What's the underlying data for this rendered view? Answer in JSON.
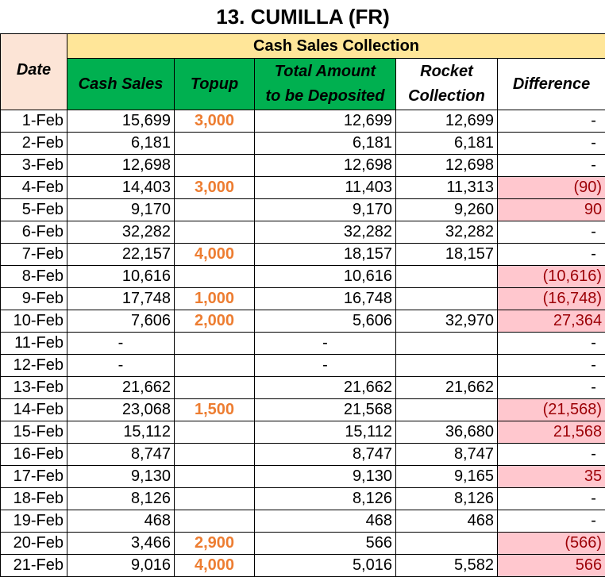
{
  "title": "13. CUMILLA (FR)",
  "header": {
    "date": "Date",
    "group": "Cash Sales Collection",
    "cash_sales": "Cash Sales",
    "topup": "Topup",
    "total_line1": "Total Amount",
    "total_line2": "to be Deposited",
    "rocket_line1": "Rocket",
    "rocket_line2": "Collection",
    "difference": "Difference"
  },
  "colors": {
    "date_header_bg": "#fce4d6",
    "group_header_bg": "#ffe699",
    "green_header_bg": "#00b050",
    "topup_text": "#ed7d31",
    "diff_highlight_bg": "#ffc7ce",
    "diff_highlight_text": "#9c0006"
  },
  "rows": [
    {
      "date": "1-Feb",
      "cash_sales": "15,699",
      "topup": "3,000",
      "total": "12,699",
      "rocket": "12,699",
      "difference": "-",
      "diff_flag": false
    },
    {
      "date": "2-Feb",
      "cash_sales": "6,181",
      "topup": "",
      "total": "6,181",
      "rocket": "6,181",
      "difference": "-",
      "diff_flag": false
    },
    {
      "date": "3-Feb",
      "cash_sales": "12,698",
      "topup": "",
      "total": "12,698",
      "rocket": "12,698",
      "difference": "-",
      "diff_flag": false
    },
    {
      "date": "4-Feb",
      "cash_sales": "14,403",
      "topup": "3,000",
      "total": "11,403",
      "rocket": "11,313",
      "difference": "(90)",
      "diff_flag": true
    },
    {
      "date": "5-Feb",
      "cash_sales": "9,170",
      "topup": "",
      "total": "9,170",
      "rocket": "9,260",
      "difference": "90",
      "diff_flag": true
    },
    {
      "date": "6-Feb",
      "cash_sales": "32,282",
      "topup": "",
      "total": "32,282",
      "rocket": "32,282",
      "difference": "-",
      "diff_flag": false
    },
    {
      "date": "7-Feb",
      "cash_sales": "22,157",
      "topup": "4,000",
      "total": "18,157",
      "rocket": "18,157",
      "difference": "-",
      "diff_flag": false
    },
    {
      "date": "8-Feb",
      "cash_sales": "10,616",
      "topup": "",
      "total": "10,616",
      "rocket": "",
      "difference": "(10,616)",
      "diff_flag": true
    },
    {
      "date": "9-Feb",
      "cash_sales": "17,748",
      "topup": "1,000",
      "total": "16,748",
      "rocket": "",
      "difference": "(16,748)",
      "diff_flag": true
    },
    {
      "date": "10-Feb",
      "cash_sales": "7,606",
      "topup": "2,000",
      "total": "5,606",
      "rocket": "32,970",
      "difference": "27,364",
      "diff_flag": true
    },
    {
      "date": "11-Feb",
      "cash_sales": "-",
      "topup": "",
      "total": "-",
      "rocket": "",
      "difference": "-",
      "diff_flag": false
    },
    {
      "date": "12-Feb",
      "cash_sales": "-",
      "topup": "",
      "total": "-",
      "rocket": "",
      "difference": "-",
      "diff_flag": false
    },
    {
      "date": "13-Feb",
      "cash_sales": "21,662",
      "topup": "",
      "total": "21,662",
      "rocket": "21,662",
      "difference": "-",
      "diff_flag": false
    },
    {
      "date": "14-Feb",
      "cash_sales": "23,068",
      "topup": "1,500",
      "total": "21,568",
      "rocket": "",
      "difference": "(21,568)",
      "diff_flag": true
    },
    {
      "date": "15-Feb",
      "cash_sales": "15,112",
      "topup": "",
      "total": "15,112",
      "rocket": "36,680",
      "difference": "21,568",
      "diff_flag": true
    },
    {
      "date": "16-Feb",
      "cash_sales": "8,747",
      "topup": "",
      "total": "8,747",
      "rocket": "8,747",
      "difference": "-",
      "diff_flag": false
    },
    {
      "date": "17-Feb",
      "cash_sales": "9,130",
      "topup": "",
      "total": "9,130",
      "rocket": "9,165",
      "difference": "35",
      "diff_flag": true
    },
    {
      "date": "18-Feb",
      "cash_sales": "8,126",
      "topup": "",
      "total": "8,126",
      "rocket": "8,126",
      "difference": "-",
      "diff_flag": false
    },
    {
      "date": "19-Feb",
      "cash_sales": "468",
      "topup": "",
      "total": "468",
      "rocket": "468",
      "difference": "-",
      "diff_flag": false
    },
    {
      "date": "20-Feb",
      "cash_sales": "3,466",
      "topup": "2,900",
      "total": "566",
      "rocket": "",
      "difference": "(566)",
      "diff_flag": true
    },
    {
      "date": "21-Feb",
      "cash_sales": "9,016",
      "topup": "4,000",
      "total": "5,016",
      "rocket": "5,582",
      "difference": "566",
      "diff_flag": true
    }
  ]
}
